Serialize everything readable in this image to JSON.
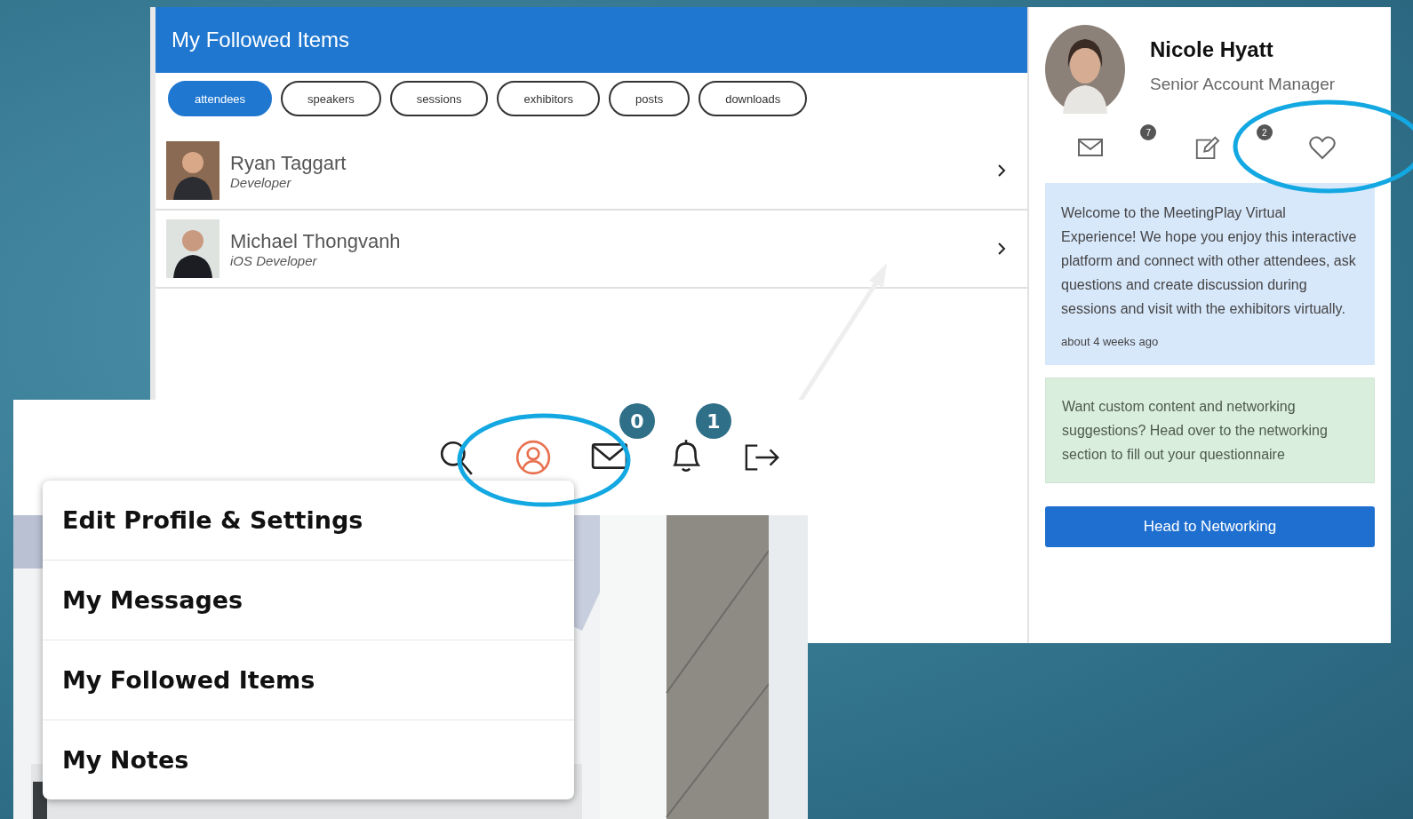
{
  "followed": {
    "title": "My Followed Items",
    "tabs": [
      {
        "label": "attendees",
        "selected": true
      },
      {
        "label": "speakers",
        "selected": false
      },
      {
        "label": "sessions",
        "selected": false
      },
      {
        "label": "exhibitors",
        "selected": false
      },
      {
        "label": "posts",
        "selected": false
      },
      {
        "label": "downloads",
        "selected": false
      }
    ],
    "people": [
      {
        "name": "Ryan Taggart",
        "role": "Developer"
      },
      {
        "name": "Michael Thongvanh",
        "role": "iOS Developer"
      }
    ]
  },
  "profile": {
    "name": "Nicole Hyatt",
    "title": "Senior Account Manager",
    "message_count": "7",
    "note_count": "2",
    "welcome": {
      "text": "Welcome to the MeetingPlay Virtual Experience! We hope you enjoy this interactive platform and connect with other attendees, ask questions and create discussion during sessions and visit with the exhibitors virtually.",
      "time": "about 4 weeks ago"
    },
    "tip": "Want custom content and networking suggestions? Head over to the networking section to fill out your questionnaire",
    "button": "Head to Networking"
  },
  "header": {
    "messages_badge": "0",
    "notifications_badge": "1",
    "menu": [
      "Edit Profile & Settings",
      "My Messages",
      "My Followed Items",
      "My Notes"
    ]
  }
}
